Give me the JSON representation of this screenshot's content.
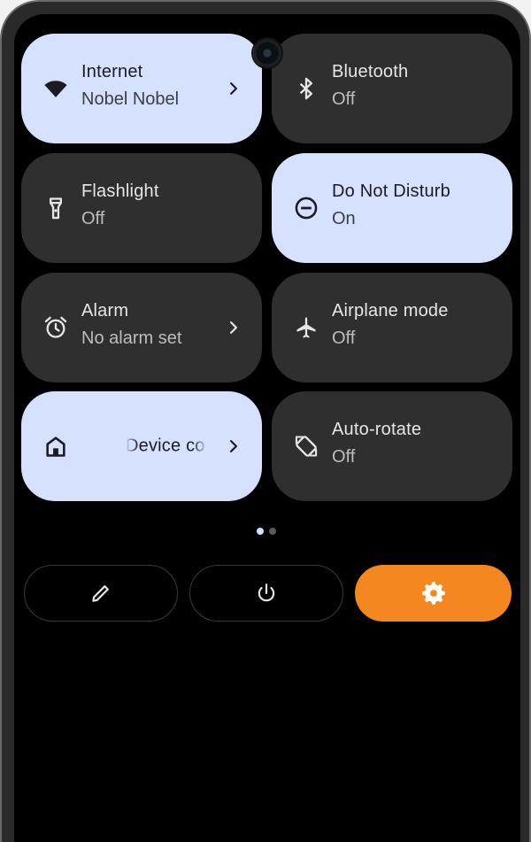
{
  "tiles": [
    {
      "id": "internet",
      "title": "Internet",
      "subtitle": "Nobel Nobel",
      "state": "active",
      "icon": "wifi-icon",
      "has_chevron": true
    },
    {
      "id": "bluetooth",
      "title": "Bluetooth",
      "subtitle": "Off",
      "state": "inactive",
      "icon": "bluetooth-icon",
      "has_chevron": false
    },
    {
      "id": "flashlight",
      "title": "Flashlight",
      "subtitle": "Off",
      "state": "inactive",
      "icon": "flashlight-icon",
      "has_chevron": false
    },
    {
      "id": "dnd",
      "title": "Do Not Disturb",
      "subtitle": "On",
      "state": "active",
      "icon": "do-not-disturb-icon",
      "has_chevron": false
    },
    {
      "id": "alarm",
      "title": "Alarm",
      "subtitle": "No alarm set",
      "state": "inactive",
      "icon": "alarm-icon",
      "has_chevron": true
    },
    {
      "id": "airplane",
      "title": "Airplane mode",
      "subtitle": "Off",
      "state": "inactive",
      "icon": "airplane-icon",
      "has_chevron": false
    },
    {
      "id": "device",
      "title": "Device co",
      "subtitle": "",
      "state": "active",
      "icon": "home-icon",
      "has_chevron": true
    },
    {
      "id": "autorotate",
      "title": "Auto-rotate",
      "subtitle": "Off",
      "state": "inactive",
      "icon": "auto-rotate-icon",
      "has_chevron": false
    }
  ],
  "pager": {
    "pages": 2,
    "current": 1
  },
  "bottom_buttons": [
    {
      "id": "edit",
      "icon": "pencil-icon"
    },
    {
      "id": "power",
      "icon": "power-icon"
    },
    {
      "id": "settings",
      "icon": "gear-icon"
    }
  ],
  "colors": {
    "active_tile": "#d6e1ff",
    "inactive_tile": "#2f2f30",
    "background": "#000000",
    "settings_accent": "#f4871f"
  }
}
